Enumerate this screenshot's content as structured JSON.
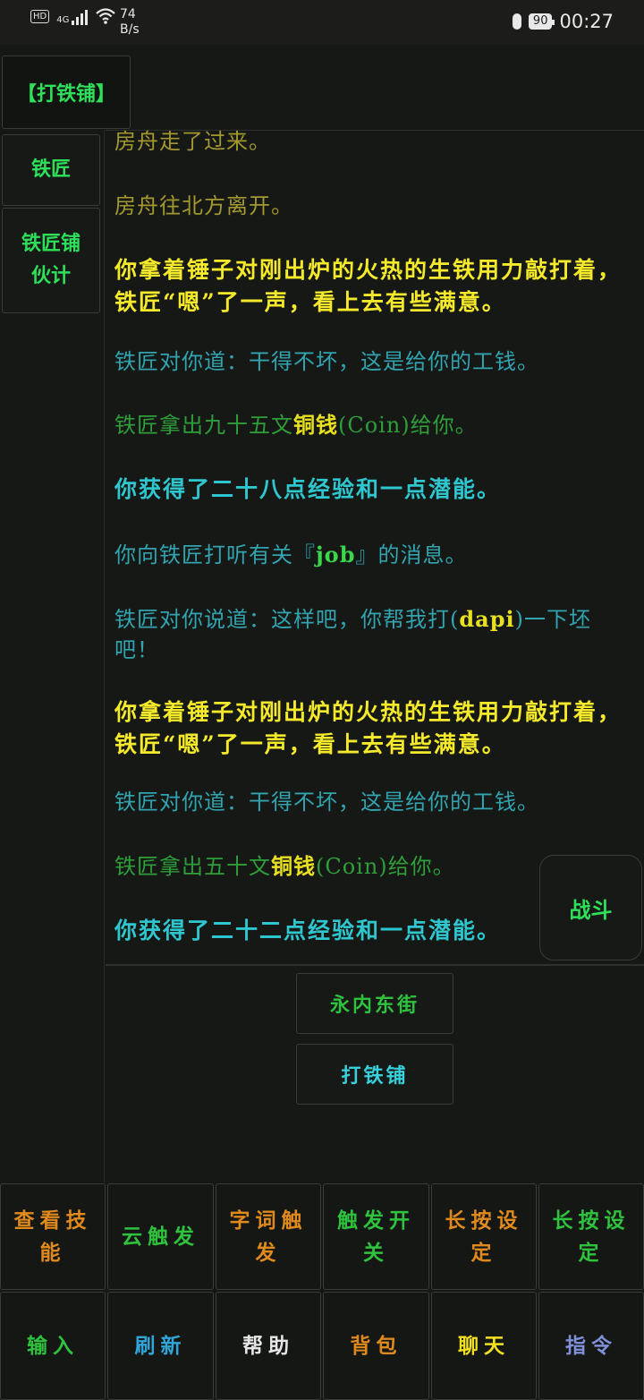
{
  "status_bar": {
    "hd": "HD",
    "network": "4G",
    "speed_value": "74",
    "speed_unit": "B/s",
    "battery": "90",
    "time": "00:27"
  },
  "room": {
    "title": "【打铁铺】"
  },
  "npcs": [
    {
      "label": "铁匠"
    },
    {
      "label": "铁匠铺\n伙计"
    }
  ],
  "log": [
    {
      "text": "房舟走了过来。"
    },
    {
      "text": "房舟往北方离开。"
    },
    {
      "text": "你拿着锤子对刚出炉的火热的生铁用力敲打着，铁匠“嗯”了一声，看上去有些满意。"
    },
    {
      "text": "铁匠对你道：干得不坏，这是给你的工钱。"
    },
    {
      "pre": "铁匠拿出九十五文",
      "item": "铜钱",
      "post": "(Coin)给你。"
    },
    {
      "text": "你获得了二十八点经验和一点潜能。"
    },
    {
      "pre": "你向铁匠打听有关『",
      "item": "job",
      "post": "』的消息。"
    },
    {
      "pre": "铁匠对你说道：这样吧，你帮我打(",
      "item": "dapi",
      "post": ")一下坯吧！"
    },
    {
      "text": "你拿着锤子对刚出炉的火热的生铁用力敲打着，铁匠“嗯”了一声，看上去有些满意。"
    },
    {
      "text": "铁匠对你道：干得不坏，这是给你的工钱。"
    },
    {
      "pre": "铁匠拿出五十文",
      "item": "铜钱",
      "post": "(Coin)给你。"
    },
    {
      "text": "你获得了二十二点经验和一点潜能。"
    }
  ],
  "fight_button": "战斗",
  "exits": [
    {
      "label": "永内东街"
    },
    {
      "label": "打铁铺"
    }
  ],
  "buttons_row1": [
    {
      "label": "查看技能",
      "color": "#e08a1e"
    },
    {
      "label": "云触发",
      "color": "#2ec23e"
    },
    {
      "label": "字词触发",
      "color": "#e08a1e"
    },
    {
      "label": "触发开关",
      "color": "#2ec23e"
    },
    {
      "label": "长按设定",
      "color": "#e08a1e"
    },
    {
      "label": "长按设定",
      "color": "#2ec23e"
    }
  ],
  "buttons_row2": [
    {
      "label": "输入",
      "color": "#2ec23e"
    },
    {
      "label": "刷新",
      "color": "#31a4d8"
    },
    {
      "label": "帮助",
      "color": "#e6e6e6"
    },
    {
      "label": "背包",
      "color": "#e08a1e"
    },
    {
      "label": "聊天",
      "color": "#f0e020"
    },
    {
      "label": "指令",
      "color": "#7f8fd8"
    }
  ]
}
